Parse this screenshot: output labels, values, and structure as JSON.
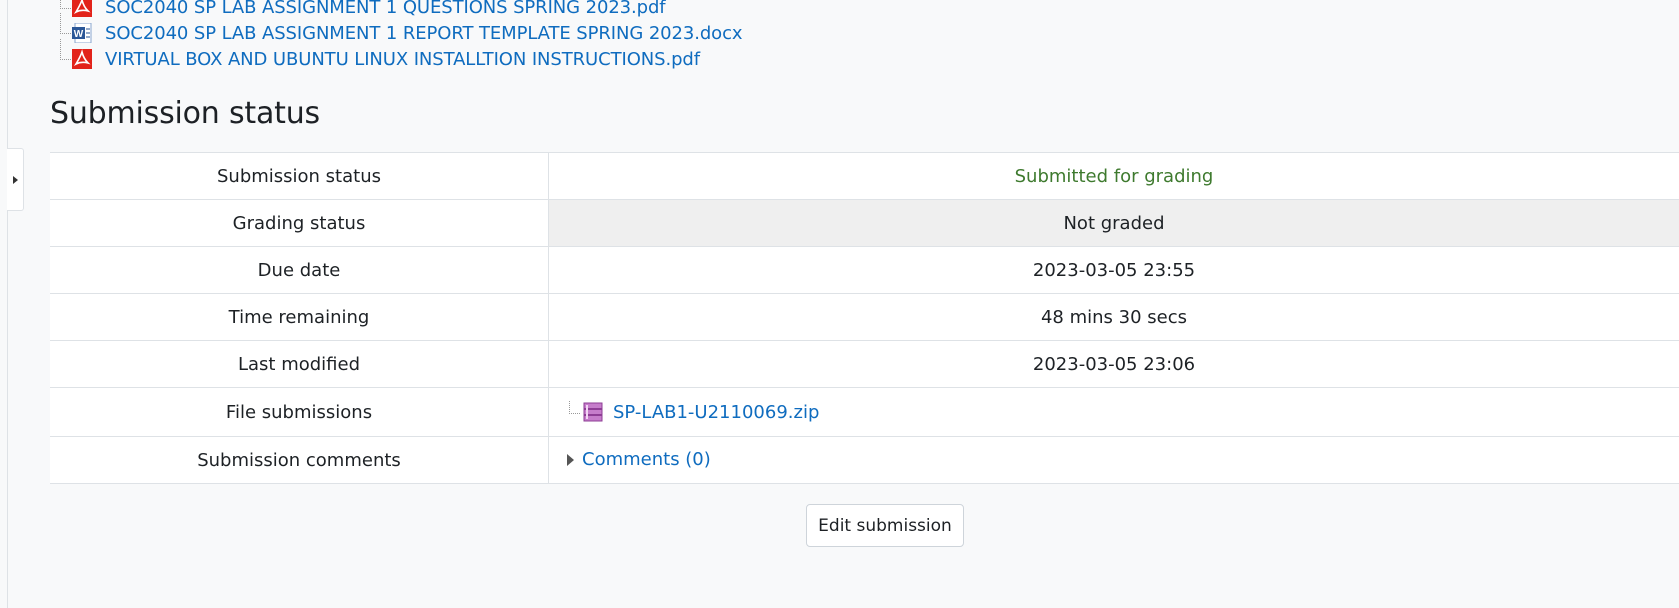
{
  "files": [
    {
      "name": "SOC2040 SP LAB ASSIGNMENT 1 QUESTIONS SPRING 2023.pdf",
      "icon": "pdf-icon"
    },
    {
      "name": "SOC2040 SP LAB ASSIGNMENT 1 REPORT TEMPLATE SPRING 2023.docx",
      "icon": "word-doc-icon"
    },
    {
      "name": "VIRTUAL BOX AND UBUNTU LINUX INSTALLTION INSTRUCTIONS.pdf",
      "icon": "pdf-icon"
    }
  ],
  "section_title": "Submission status",
  "table": {
    "rows": [
      {
        "label": "Submission status",
        "value": "Submitted for grading"
      },
      {
        "label": "Grading status",
        "value": "Not graded"
      },
      {
        "label": "Due date",
        "value": "2023-03-05 23:55"
      },
      {
        "label": "Time remaining",
        "value": "48 mins 30 secs"
      },
      {
        "label": "Last modified",
        "value": "2023-03-05 23:06"
      },
      {
        "label": "File submissions",
        "value": "SP-LAB1-U2110069.zip"
      },
      {
        "label": "Submission comments",
        "value": "Comments (0)"
      }
    ]
  },
  "edit_button": "Edit submission",
  "colors": {
    "link": "#0f6cbf",
    "submitted": "#3e7a2e",
    "grey_cell": "#efefef",
    "pdf": "#e2231a",
    "zip": "#b04fb7"
  }
}
